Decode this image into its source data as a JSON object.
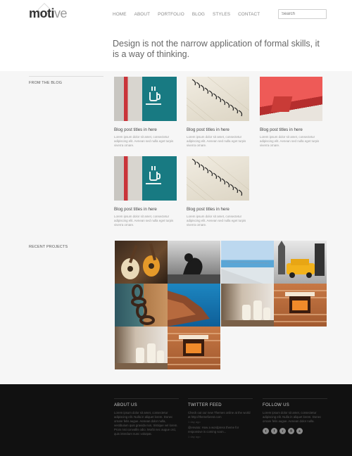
{
  "header": {
    "logo_main": "moti",
    "logo_accent": "ve",
    "nav": [
      "HOME",
      "ABOUT",
      "PORTFOLIO",
      "BLOG",
      "STYLES",
      "CONTACT"
    ],
    "search_placeholder": "Search",
    "tagline": "Design is not the narrow application of formal skills, it is a way of thinking."
  },
  "blog": {
    "label": "FROM THE BLOG",
    "posts": [
      {
        "title": "Blog post titles in here",
        "excerpt": "Lorem ipsum dolor sit amet, consectetur adipiscing elit. Aenean sed nulla eget turpis viverra ornare.",
        "image": "coffee-cup-sign"
      },
      {
        "title": "Blog post titles in here",
        "excerpt": "Lorem ipsum dolor sit amet, consectetur adipiscing elit. Aenean sed nulla eget turpis viverra ornare.",
        "image": "spiral-notebook"
      },
      {
        "title": "Blog post titles in here",
        "excerpt": "Lorem ipsum dolor sit amet, consectetur adipiscing elit. Aenean sed nulla eget turpis viverra ornare.",
        "image": "red-object"
      },
      {
        "title": "Blog post titles in here",
        "excerpt": "Lorem ipsum dolor sit amet, consectetur adipiscing elit. Aenean sed nulla eget turpis viverra ornare.",
        "image": "coffee-cup-sign"
      },
      {
        "title": "Blog post titles in here",
        "excerpt": "Lorem ipsum dolor sit amet, consectetur adipiscing elit. Aenean sed nulla eget turpis viverra ornare.",
        "image": "spiral-notebook"
      }
    ]
  },
  "projects": {
    "label": "RECENT PROJECTS",
    "tiles": [
      "guitars",
      "figure-bw",
      "pier-sea",
      "yellow-car",
      "chain",
      "rock-coast",
      "candles",
      "fireplace",
      "candles",
      "fireplace"
    ]
  },
  "footer": {
    "about_title": "ABOUT US",
    "about_text": "Lorem ipsum dolor sit amet, consectetur adipiscing elit. Nulla in aliquet lorem. Donec ornare felis augue. Aenean dolor nulla, vestibulum quis gravida non, tristique vel lorem. Proin nisi convallis odio. Morbi nec augue orci, quis interdum nunc volutpat.",
    "twitter_title": "TWITTER FEED",
    "tweet1": "Check out our new Themes online at the world at http://themeforest.com",
    "tweet1_meta": "1 day ago",
    "tweet2": "@envato: How a wordpress theme for responsive is coming soon...",
    "tweet2_meta": "1 day ago",
    "follow_title": "FOLLOW US",
    "follow_text": "Lorem ipsum dolor sit amet, consectetur adipiscing elit. Nulla in aliquet lorem. Donec ornare felis augue. Aenean dolor nulla.",
    "socials": [
      "twitter",
      "facebook",
      "rss",
      "flickr",
      "skype"
    ],
    "social_glyphs": [
      "t",
      "f",
      "r",
      "fl",
      "s"
    ]
  }
}
